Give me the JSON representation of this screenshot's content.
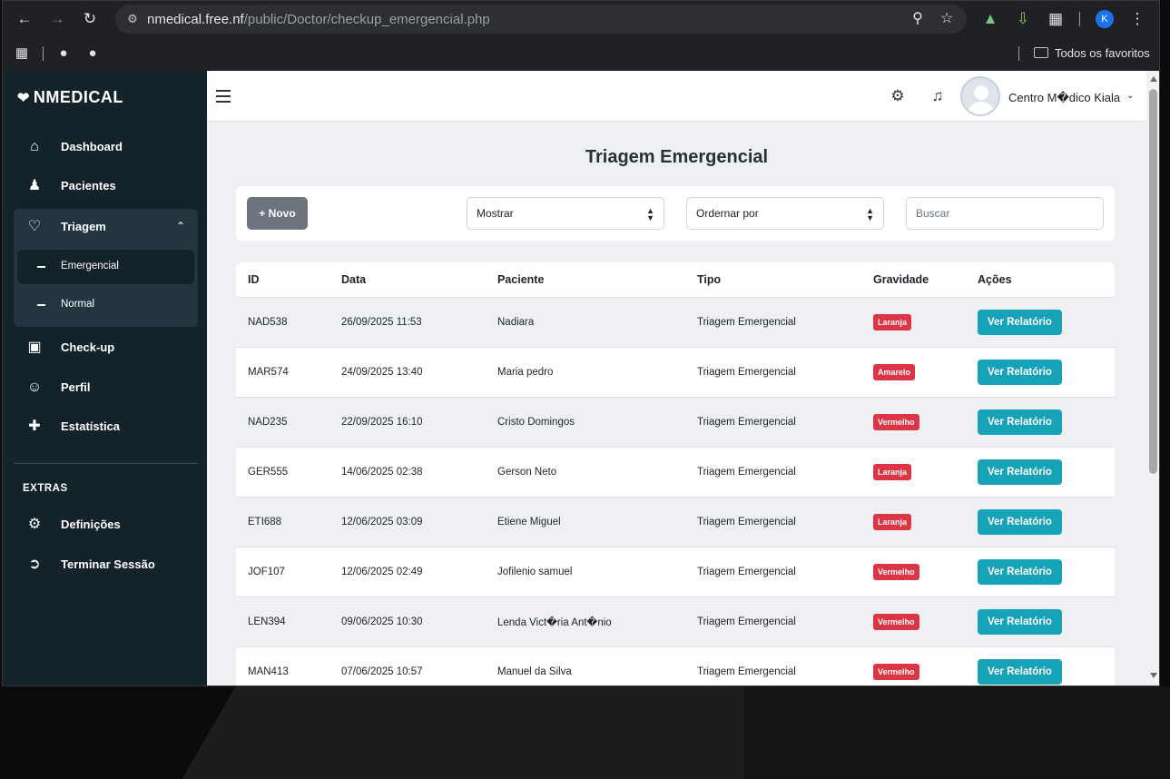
{
  "browser": {
    "url_host": "nmedical.free.nf",
    "url_path": "/public/Doctor/checkup_emergencial.php",
    "profile_initial": "K",
    "bookmarks_folder": "Todos os favoritos"
  },
  "sidebar": {
    "brand": "NMEDICAL",
    "items": [
      {
        "label": "Dashboard",
        "icon": "home-icon"
      },
      {
        "label": "Pacientes",
        "icon": "users-icon"
      },
      {
        "label": "Triagem",
        "icon": "heartbeat-icon"
      },
      {
        "label": "Check-up",
        "icon": "tablet-icon"
      },
      {
        "label": "Perfil",
        "icon": "user-circle-icon"
      },
      {
        "label": "Estatística",
        "icon": "ambulance-icon"
      }
    ],
    "triagem_sub": [
      {
        "label": "Emergencial",
        "active": true
      },
      {
        "label": "Normal",
        "active": false
      }
    ],
    "extras_heading": "EXTRAS",
    "extras": [
      {
        "label": "Definições",
        "icon": "gear-icon"
      },
      {
        "label": "Terminar Sessão",
        "icon": "logout-icon"
      }
    ]
  },
  "header": {
    "user_name": "Centro M�dico Kiala"
  },
  "main": {
    "title": "Triagem Emergencial",
    "new_button": "+ Novo",
    "show_select": "Mostrar",
    "order_select": "Ordernar por",
    "search_placeholder": "Buscar"
  },
  "table": {
    "columns": [
      "ID",
      "Data",
      "Paciente",
      "Tipo",
      "Gravidade",
      "Ações"
    ],
    "action_label": "Ver Relatório",
    "rows": [
      {
        "id": "NAD538",
        "date": "26/09/2025 11:53",
        "patient": "Nadiara",
        "type": "Triagem Emergencial",
        "severity": "Laranja"
      },
      {
        "id": "MAR574",
        "date": "24/09/2025 13:40",
        "patient": "Maria pedro",
        "type": "Triagem Emergencial",
        "severity": "Amarelo"
      },
      {
        "id": "NAD235",
        "date": "22/09/2025 16:10",
        "patient": "Cristo Domingos",
        "type": "Triagem Emergencial",
        "severity": "Vermelho"
      },
      {
        "id": "GER555",
        "date": "14/06/2025 02:38",
        "patient": "Gerson Neto",
        "type": "Triagem Emergencial",
        "severity": "Laranja"
      },
      {
        "id": "ETI688",
        "date": "12/06/2025 03:09",
        "patient": "Etiene Miguel",
        "type": "Triagem Emergencial",
        "severity": "Laranja"
      },
      {
        "id": "JOF107",
        "date": "12/06/2025 02:49",
        "patient": "Jofilenio samuel",
        "type": "Triagem Emergencial",
        "severity": "Vermelho"
      },
      {
        "id": "LEN394",
        "date": "09/06/2025 10:30",
        "patient": "Lenda Vict�ria Ant�nio",
        "type": "Triagem Emergencial",
        "severity": "Vermelho"
      },
      {
        "id": "MAN413",
        "date": "07/06/2025 10:57",
        "patient": "Manuel da Silva",
        "type": "Triagem Emergencial",
        "severity": "Vermelho"
      }
    ]
  },
  "colors": {
    "sidebar_bg": "#14222a",
    "badge": "#dc3545",
    "action_button": "#17a2b8",
    "new_button": "#6c757d"
  }
}
